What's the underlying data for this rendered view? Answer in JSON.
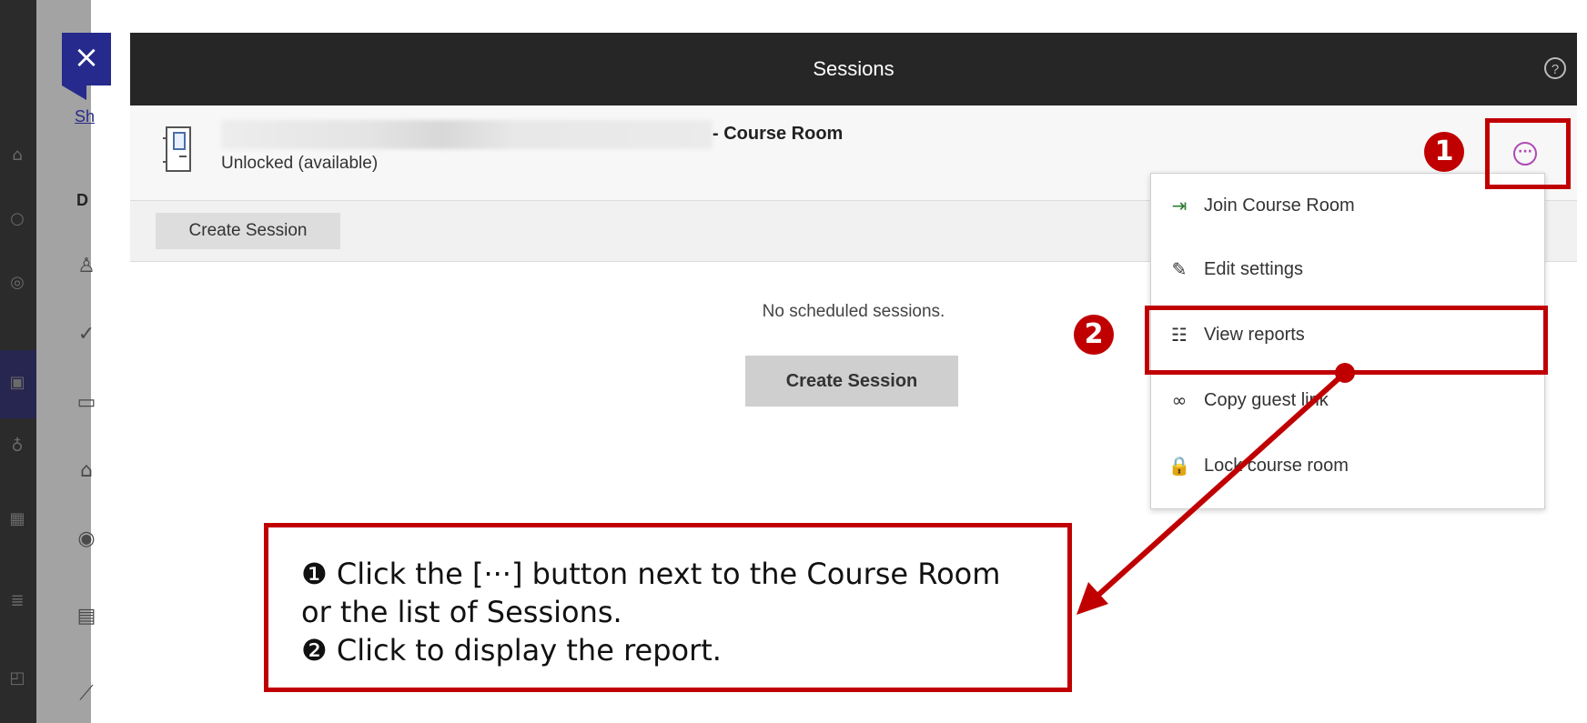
{
  "window": {
    "close_glyph": "×"
  },
  "panel": {
    "title": "Sessions",
    "help_glyph": "?"
  },
  "room": {
    "name_suffix": "- Course Room",
    "status": "Unlocked (available)",
    "more_glyph": "···"
  },
  "toolbar": {
    "create_label": "Create Session"
  },
  "main": {
    "empty_text": "No scheduled sessions.",
    "create_label": "Create Session"
  },
  "menu": {
    "items": [
      {
        "label": "Join Course Room",
        "icon": "join-icon",
        "glyph": "⇥"
      },
      {
        "label": "Edit settings",
        "icon": "pencil-icon",
        "glyph": "✎"
      },
      {
        "label": "View reports",
        "icon": "report-icon",
        "glyph": "☷"
      },
      {
        "label": "Copy guest link",
        "icon": "link-icon",
        "glyph": "∞"
      },
      {
        "label": "Lock course room",
        "icon": "lock-icon",
        "glyph": "🔒"
      }
    ]
  },
  "annotations": {
    "badge1": "1",
    "badge2": "2",
    "callout_line1": "❶ Click the [···] button next to the Course Room",
    "callout_line2": "or the list of Sessions.",
    "callout_line3": "❷ Click to display the report.",
    "color": "#c00000"
  },
  "background": {
    "strip_link": "Sh",
    "strip_header": "D"
  }
}
